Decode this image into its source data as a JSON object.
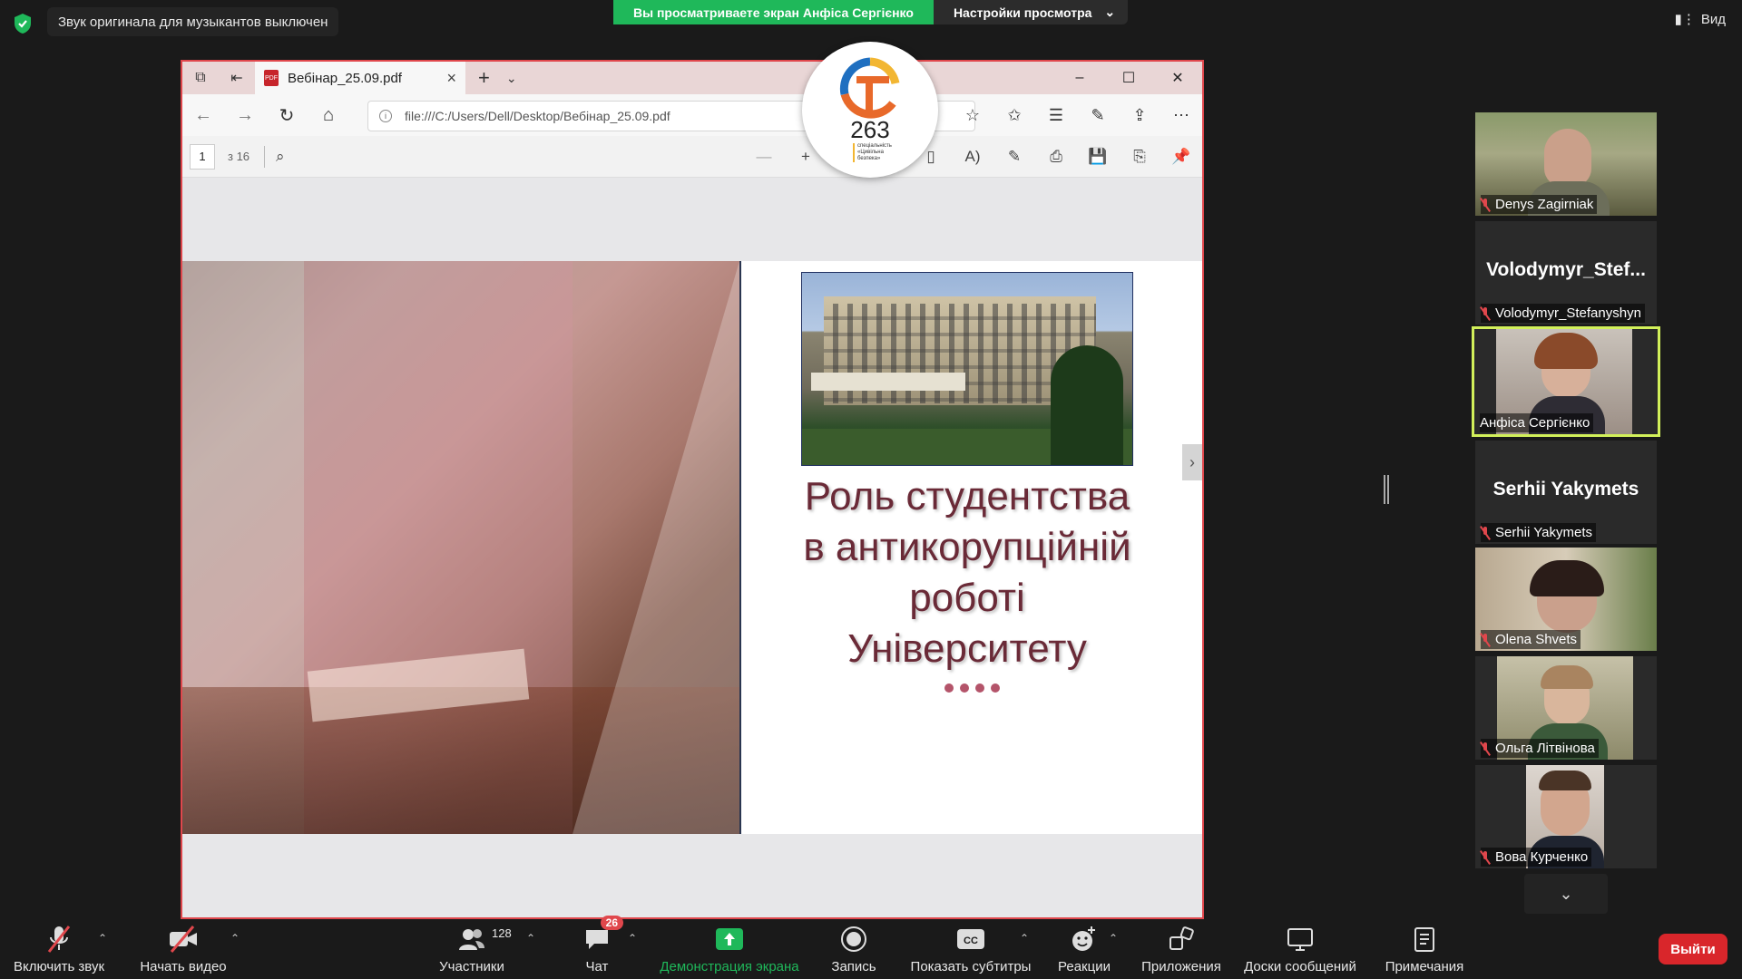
{
  "topbar": {
    "notice": "Звук оригинала для музыкантов выключен",
    "share_status": "Вы просматриваете экран Анфіса Сергієнко",
    "view_options": "Настройки просмотра",
    "view_label": "Вид"
  },
  "browser": {
    "tab_title": "Вебінар_25.09.pdf",
    "address": "file:///C:/Users/Dell/Desktop/Вебінар_25.09.pdf",
    "page_current": "1",
    "page_total": "з 16"
  },
  "slide": {
    "title_lines": [
      "Роль студентства",
      "в антикорупційній",
      "роботі",
      "Університету"
    ]
  },
  "logo": {
    "number": "263",
    "caption": "спеціальність «Цивільна безпека»"
  },
  "participants": [
    {
      "name": "Denys Zagirniak",
      "type": "video"
    },
    {
      "name": "Volodymyr_Stefanyshyn",
      "display": "Volodymyr_Stef...",
      "type": "name"
    },
    {
      "name": "Анфіса Сергієнко",
      "type": "video",
      "active": true
    },
    {
      "name": "Serhii Yakymets",
      "display": "Serhii Yakymets",
      "type": "name"
    },
    {
      "name": "Olena Shvets",
      "type": "video"
    },
    {
      "name": "Ольга Літвінова",
      "type": "video"
    },
    {
      "name": "Вова Курченко",
      "type": "video"
    }
  ],
  "bottombar": {
    "unmute": "Включить звук",
    "start_video": "Начать видео",
    "participants": "Участники",
    "participants_count": "128",
    "chat": "Чат",
    "chat_badge": "26",
    "share_screen": "Демонстрация экрана",
    "record": "Запись",
    "captions": "Показать субтитры",
    "reactions": "Реакции",
    "apps": "Приложения",
    "whiteboards": "Доски сообщений",
    "notes": "Примечания",
    "leave": "Выйти"
  },
  "colors": {
    "accent_green": "#1fb85a",
    "leave_red": "#d9262b",
    "slide_title": "#6a2a37",
    "active_speaker": "#d2f05a"
  }
}
